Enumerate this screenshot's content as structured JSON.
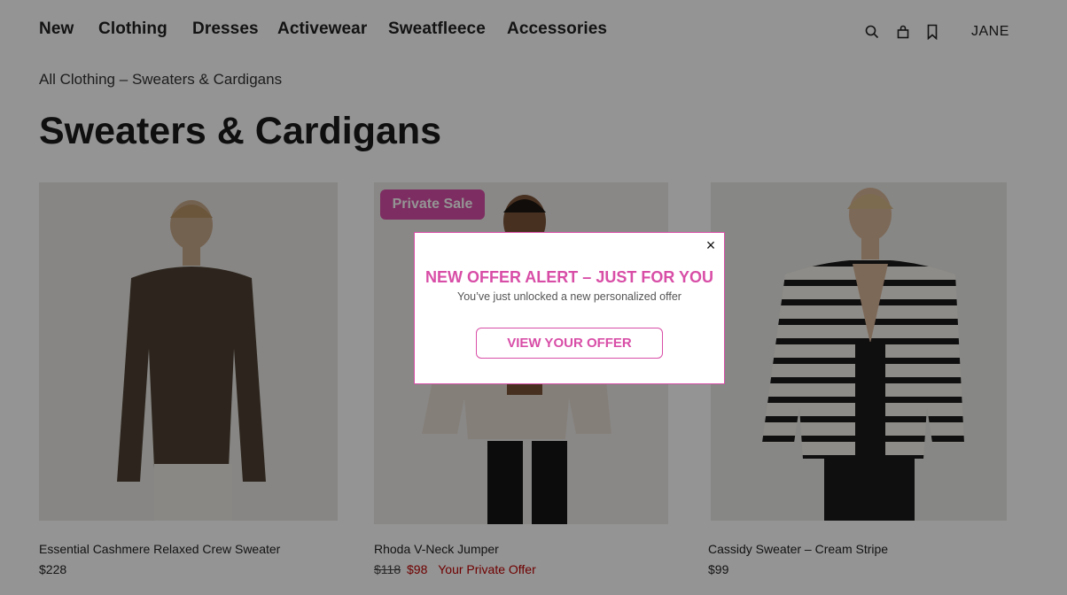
{
  "nav": {
    "items": [
      "New",
      "Clothing",
      "Dresses",
      "Activewear",
      "Sweatfleece",
      "Accessories"
    ],
    "icons": [
      "search-icon",
      "shopping-bag-icon",
      "bookmark-icon"
    ],
    "user_label": "JANE"
  },
  "breadcrumb": {
    "parent": "All Clothing",
    "separator": "–",
    "current": "Sweaters & Cardigans"
  },
  "page_title": "Sweaters & Cardigans",
  "products": [
    {
      "name": "Essential Cashmere Relaxed Crew Sweater",
      "price": "$228"
    },
    {
      "name": "Rhoda V-Neck Jumper",
      "badge": "Private Sale",
      "original_price": "$118",
      "sale_price": "$98",
      "offer_label": "Your Private Offer"
    },
    {
      "name": "Cassidy Sweater – Cream Stripe",
      "price": "$99"
    }
  ],
  "modal": {
    "close_label": "×",
    "headline": "NEW OFFER ALERT – JUST FOR YOU",
    "subtext": "You’ve just unlocked a new personalized offer",
    "cta": "VIEW YOUR OFFER"
  },
  "colors": {
    "accent": "#d84ea7",
    "sale_red": "#c00000",
    "overlay": "rgba(0,0,0,0.42)"
  }
}
